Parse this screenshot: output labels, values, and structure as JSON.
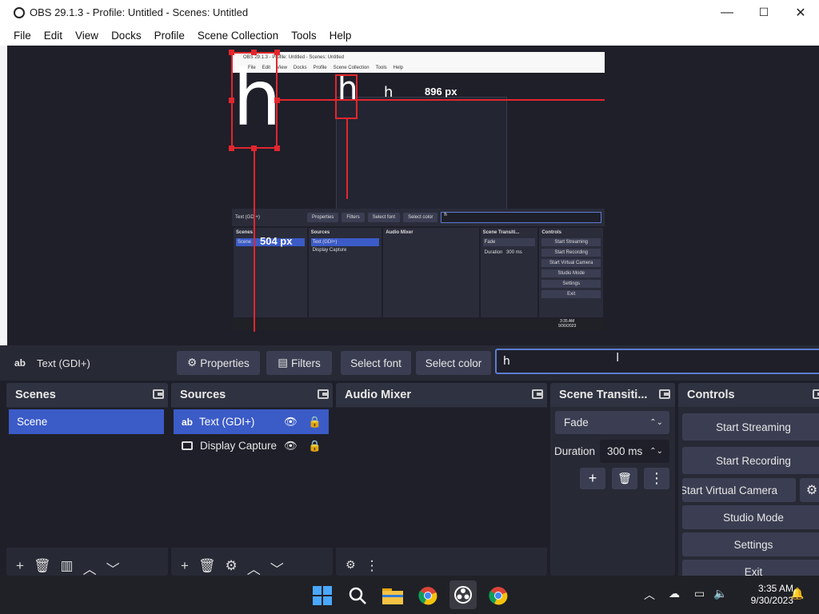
{
  "window": {
    "title": "OBS 29.1.3 - Profile: Untitled - Scenes: Untitled",
    "controls": {
      "minimize": "—",
      "maximize": "☐",
      "close": "✕"
    }
  },
  "menu": [
    "File",
    "Edit",
    "View",
    "Docks",
    "Profile",
    "Scene Collection",
    "Tools",
    "Help"
  ],
  "preview": {
    "text_char": "h",
    "width_label": "896 px",
    "height_label": "504 px",
    "mini_title": "OBS 29.1.3 - Profile: Untitled - Scenes: Untitled",
    "mini_menu": [
      "File",
      "Edit",
      "View",
      "Docks",
      "Profile",
      "Scene Collection",
      "Tools",
      "Help"
    ],
    "mini_toolbar": {
      "source": "Text (GDI+)",
      "properties": "Properties",
      "filters": "Filters",
      "select_font": "Select font",
      "select_color": "Select color",
      "text": "h"
    },
    "mini_docks": {
      "scenes": "Scenes",
      "scene": "Scene",
      "sources": "Sources",
      "src1": "Text (GDI+)",
      "src2": "Display Capture",
      "audio": "Audio Mixer",
      "transitions": "Scene Transiti...",
      "fade": "Fade",
      "duration": "Duration",
      "duration_val": "300 ms",
      "controls": "Controls",
      "buttons": [
        "Start Streaming",
        "Start Recording",
        "Start Virtual Camera",
        "Studio Mode",
        "Settings",
        "Exit"
      ]
    },
    "mini_clock": {
      "time": "3:35 AM",
      "date": "9/30/2023"
    }
  },
  "source_toolbar": {
    "source_type_icon": "ab",
    "source_name": "Text (GDI+)",
    "properties": "Properties",
    "filters": "Filters",
    "select_font": "Select font",
    "select_color": "Select color",
    "text_value": "h"
  },
  "docks": {
    "scenes": {
      "title": "Scenes",
      "items": [
        "Scene"
      ]
    },
    "sources": {
      "title": "Sources",
      "items": [
        {
          "icon": "text-icon",
          "label": "Text (GDI+)"
        },
        {
          "icon": "display-icon",
          "label": "Display Capture"
        }
      ]
    },
    "audio_mixer": {
      "title": "Audio Mixer"
    },
    "transitions": {
      "title": "Scene Transiti...",
      "transition": "Fade",
      "duration_label": "Duration",
      "duration_value": "300 ms"
    },
    "controls": {
      "title": "Controls",
      "start_streaming": "Start Streaming",
      "start_recording": "Start Recording",
      "start_virtual_camera": "Start Virtual Camera",
      "studio_mode": "Studio Mode",
      "settings": "Settings",
      "exit": "Exit"
    }
  },
  "taskbar": {
    "time": "3:35 AM",
    "date": "9/30/2023"
  },
  "colors": {
    "accent": "#3b5bc7",
    "selection_red": "#e3262d",
    "dock_bg": "#272935",
    "panel_bg": "#1e1f29",
    "button_bg": "#3b3e52"
  }
}
